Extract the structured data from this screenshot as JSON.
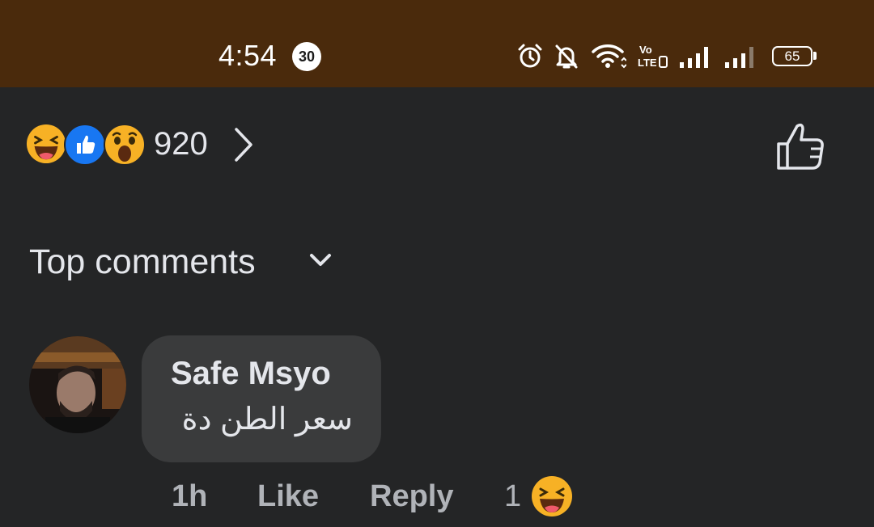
{
  "status_bar": {
    "time": "4:54",
    "notification_badge": "30",
    "battery": "65",
    "icons": [
      "alarm-icon",
      "bell-off-icon",
      "wifi-icon",
      "volte-icon",
      "signal-icon",
      "signal-icon"
    ],
    "background": "#4a2a0c"
  },
  "reactions": {
    "types": [
      "haha",
      "like",
      "wow"
    ],
    "count": "920"
  },
  "sort": {
    "label": "Top comments"
  },
  "comment": {
    "author": "Safe Msyo",
    "text": "سعر الطن دة",
    "time": "1h",
    "like_label": "Like",
    "reply_label": "Reply",
    "reaction_count": "1",
    "reaction_type": "haha"
  },
  "colors": {
    "background": "#242526",
    "bubble": "#3a3b3c",
    "text_primary": "#e4e6eb",
    "text_secondary": "#b0b3b8",
    "like_blue": "#1877f2",
    "emoji_yellow": "#f7b125"
  }
}
